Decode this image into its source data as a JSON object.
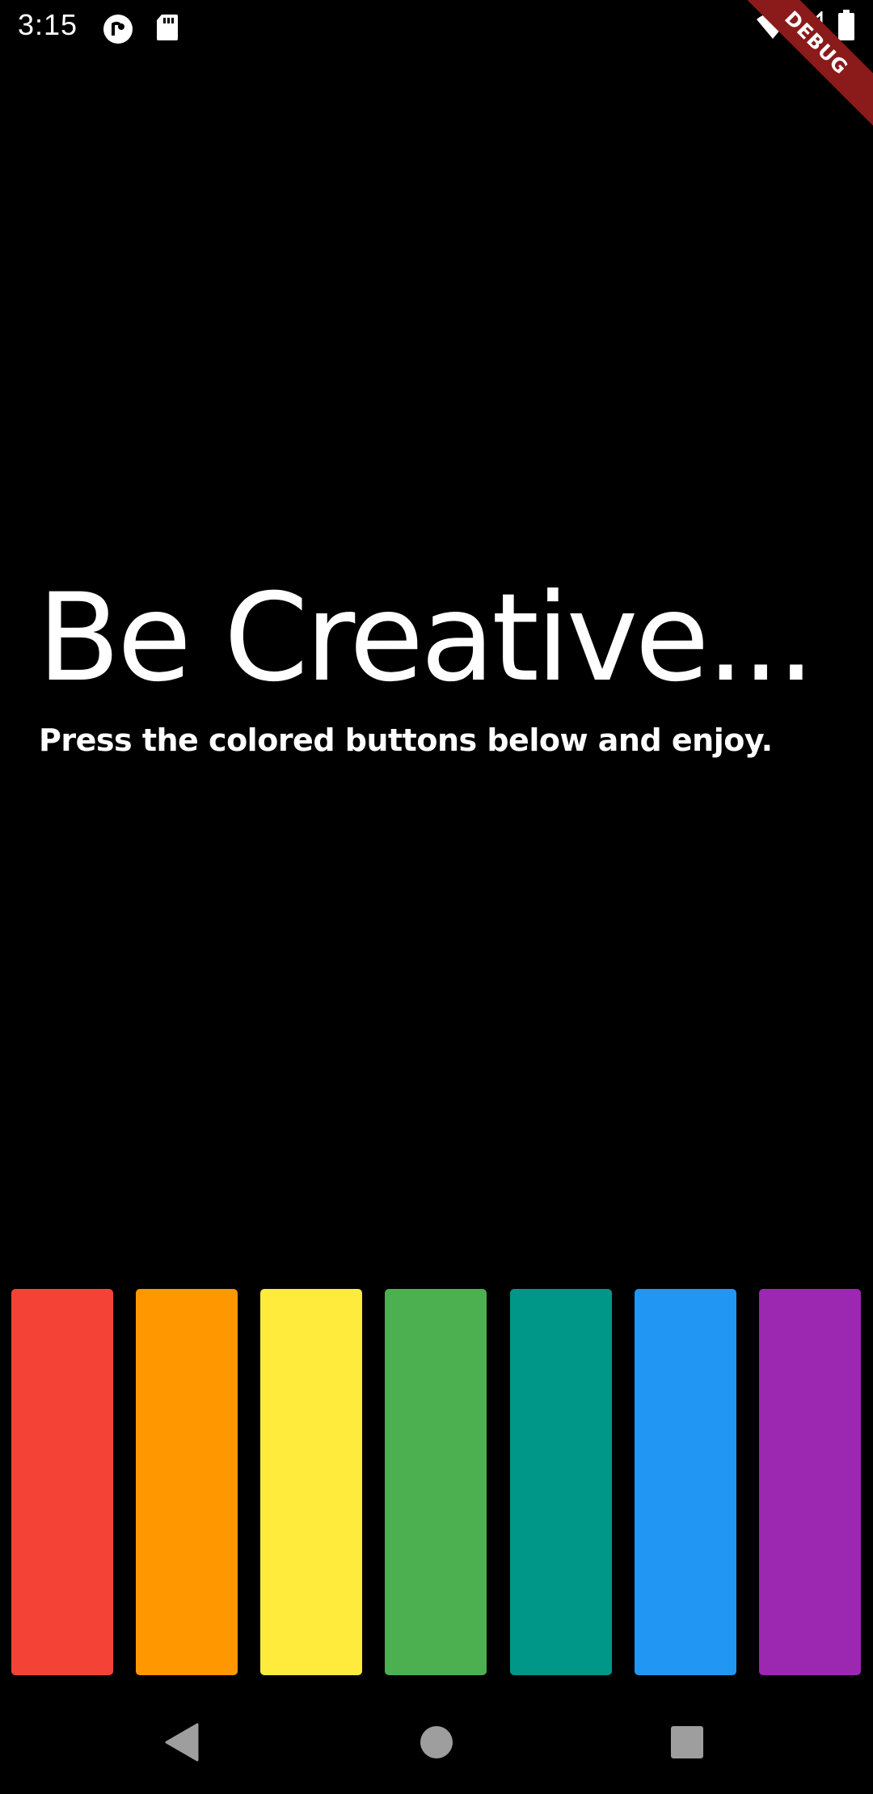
{
  "status_bar": {
    "time": "3:15",
    "left_icons": [
      "pocket-casts-icon",
      "sd-card-icon"
    ],
    "right_icons": [
      "wifi-icon",
      "cell-signal-icon",
      "battery-icon"
    ]
  },
  "debug_banner": {
    "label": "DEBUG",
    "color": "#8b1a1a"
  },
  "main": {
    "title": "Be Creative...",
    "subtitle": "Press the colored buttons below and enjoy."
  },
  "color_buttons": [
    {
      "name": "red",
      "color": "#f44336"
    },
    {
      "name": "orange",
      "color": "#ff9800"
    },
    {
      "name": "yellow",
      "color": "#ffeb3b"
    },
    {
      "name": "green",
      "color": "#4caf50"
    },
    {
      "name": "teal",
      "color": "#009688"
    },
    {
      "name": "blue",
      "color": "#2196f3"
    },
    {
      "name": "purple",
      "color": "#9c27b0"
    }
  ],
  "nav_bar": {
    "buttons": [
      "back-icon",
      "home-icon",
      "recents-icon"
    ],
    "icon_color": "#9e9e9e"
  }
}
